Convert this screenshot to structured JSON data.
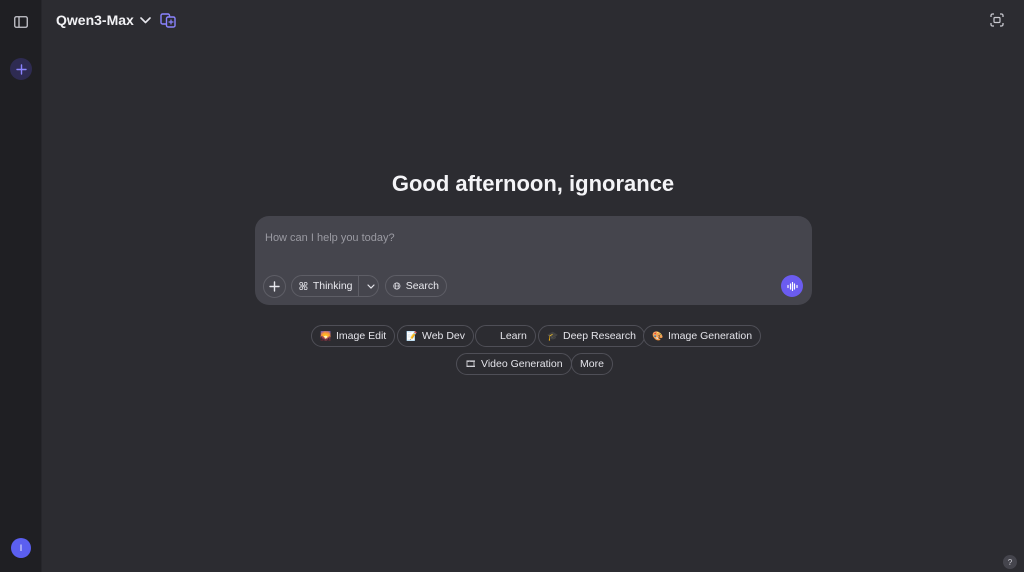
{
  "sidebar": {
    "toggle_icon": "sidebar-panel-icon",
    "new_chat_icon": "plus-icon",
    "avatar_initial": "I"
  },
  "header": {
    "model_name": "Qwen3-Max",
    "model_chevron_icon": "chevron-down-icon",
    "compare_icon": "compare-models-icon",
    "temporary_chat_icon": "temporary-chat-icon"
  },
  "main": {
    "greeting": "Good afternoon, ignorance"
  },
  "composer": {
    "placeholder": "How can I help you today?",
    "value": "",
    "attach_icon": "plus-icon",
    "thinking_label": "Thinking",
    "search_label": "Search",
    "voice_icon": "voice-waveform-icon"
  },
  "suggestions": [
    {
      "label": "Image Edit",
      "emoji": "🌄"
    },
    {
      "label": "Web Dev",
      "emoji": "📝"
    },
    {
      "label": "Learn",
      "emoji": ""
    },
    {
      "label": "Deep Research",
      "emoji": "🎓"
    },
    {
      "label": "Image Generation",
      "emoji": "🎨"
    },
    {
      "label": "Video Generation",
      "emoji": "🎞"
    },
    {
      "label": "More",
      "emoji": ""
    }
  ],
  "help": {
    "label": "?"
  },
  "colors": {
    "background": "#2c2c31",
    "sidebar": "#1f1f23",
    "composer": "#45454d",
    "accent": "#6b5cf0"
  }
}
